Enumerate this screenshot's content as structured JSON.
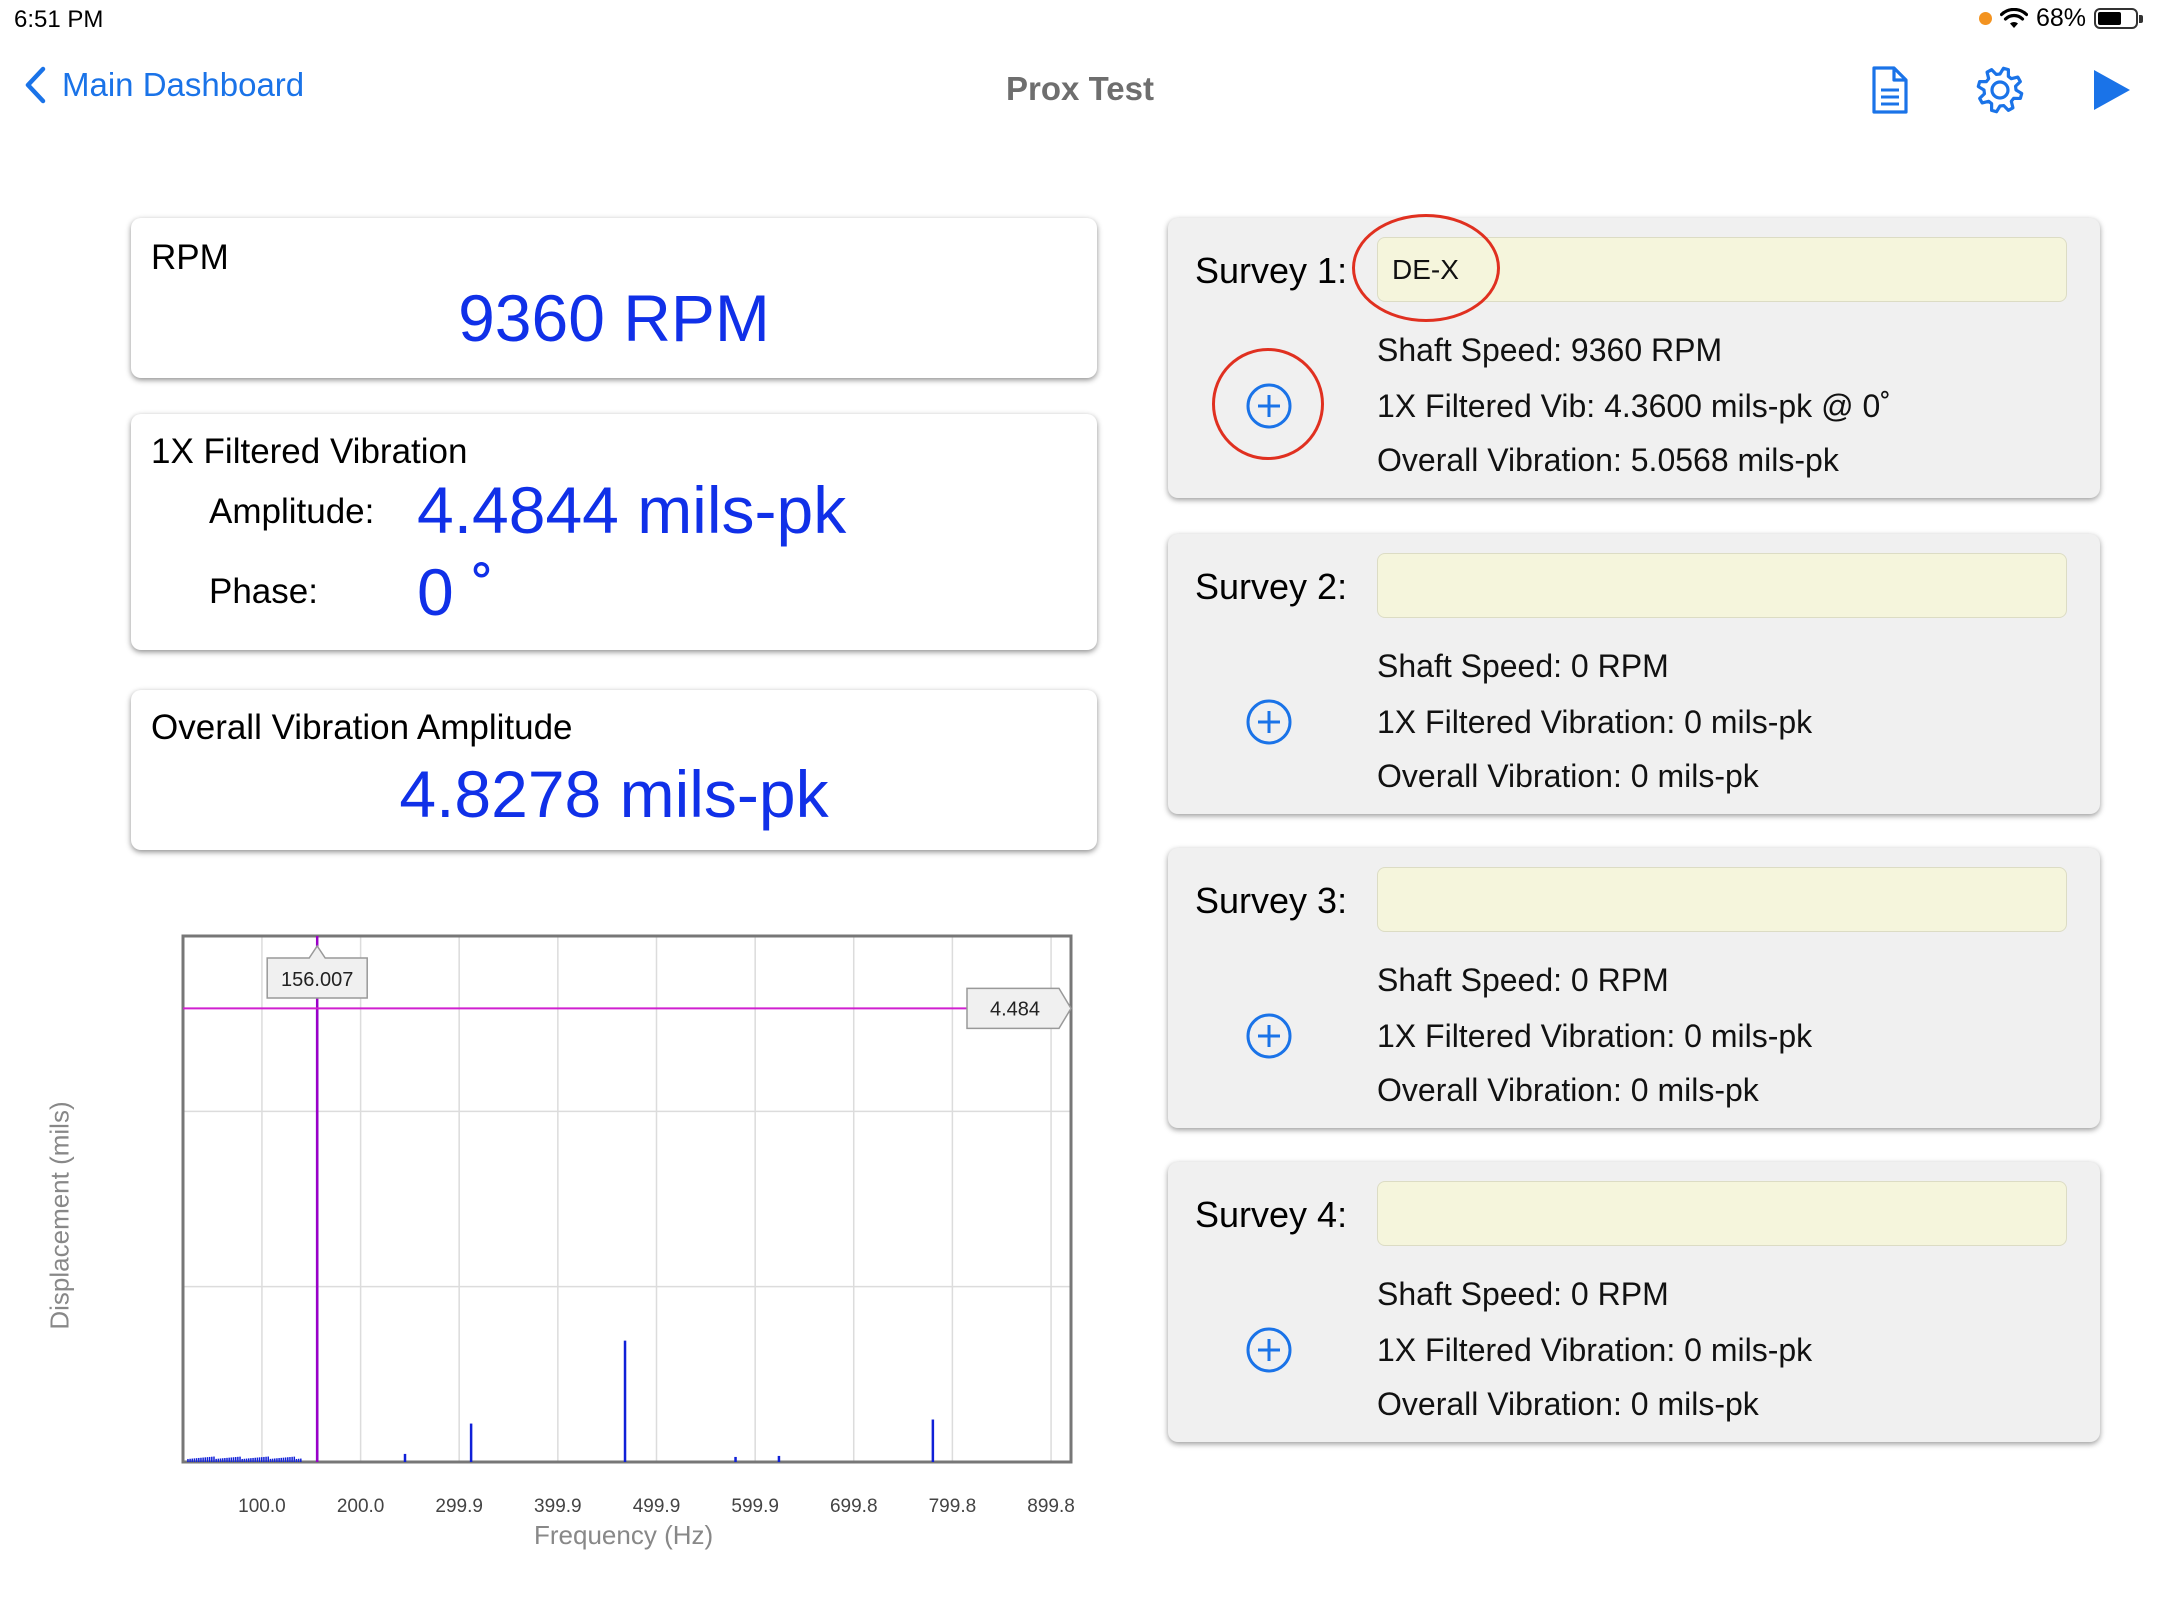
{
  "status": {
    "time": "6:51 PM",
    "battery": "68%",
    "battery_level": 0.68
  },
  "nav": {
    "back_label": "Main Dashboard",
    "title": "Prox Test",
    "icons": [
      "document-icon",
      "gear-icon",
      "play-icon"
    ]
  },
  "rpm_card": {
    "label": "RPM",
    "value": "9360 RPM"
  },
  "filtered_card": {
    "label": "1X Filtered Vibration",
    "amplitude_label": "Amplitude:",
    "amplitude_value": "4.4844 mils-pk",
    "phase_label": "Phase:",
    "phase_value": "0 ˚"
  },
  "overall_card": {
    "label": "Overall Vibration Amplitude",
    "value": "4.8278 mils-pk"
  },
  "surveys": [
    {
      "label": "Survey 1:",
      "name": "DE-X",
      "shaft_speed": "Shaft Speed: 9360 RPM",
      "filtered": "1X Filtered Vib: 4.3600 mils-pk @ 0˚",
      "overall": "Overall Vibration: 5.0568 mils-pk"
    },
    {
      "label": "Survey 2:",
      "name": "",
      "shaft_speed": "Shaft Speed: 0 RPM",
      "filtered": "1X Filtered Vibration: 0 mils-pk",
      "overall": "Overall Vibration: 0 mils-pk"
    },
    {
      "label": "Survey 3:",
      "name": "",
      "shaft_speed": "Shaft Speed: 0 RPM",
      "filtered": "1X Filtered Vibration: 0 mils-pk",
      "overall": "Overall Vibration: 0 mils-pk"
    },
    {
      "label": "Survey 4:",
      "name": "",
      "shaft_speed": "Shaft Speed: 0 RPM",
      "filtered": "1X Filtered Vibration: 0 mils-pk",
      "overall": "Overall Vibration: 0 mils-pk"
    }
  ],
  "chart_data": {
    "type": "line",
    "xlabel": "Frequency (Hz)",
    "ylabel": "Displacement (mils)",
    "x_tick_labels": [
      "100.0",
      "200.0",
      "299.9",
      "399.9",
      "499.9",
      "599.9",
      "699.8",
      "799.8",
      "899.8"
    ],
    "x_ticks": [
      100.0,
      200.0,
      299.9,
      399.9,
      499.9,
      599.9,
      699.8,
      799.8,
      899.8
    ],
    "xlim": [
      20,
      920
    ],
    "ylim": [
      0,
      5.2
    ],
    "grid": true,
    "cursor": {
      "x": 156.007,
      "y": 4.484,
      "x_label": "156.007",
      "y_label": "4.484"
    },
    "series": [
      {
        "color": "#1020d8",
        "peaks": [
          {
            "x": 156.0,
            "y": 4.484
          },
          {
            "x": 245.0,
            "y": 0.08
          },
          {
            "x": 312.0,
            "y": 0.38
          },
          {
            "x": 468.0,
            "y": 1.2
          },
          {
            "x": 580.0,
            "y": 0.05
          },
          {
            "x": 624.0,
            "y": 0.06
          },
          {
            "x": 780.0,
            "y": 0.42
          }
        ]
      }
    ],
    "cursor_color": "#d020d0",
    "cursor_x_color": "#9a00c8"
  }
}
